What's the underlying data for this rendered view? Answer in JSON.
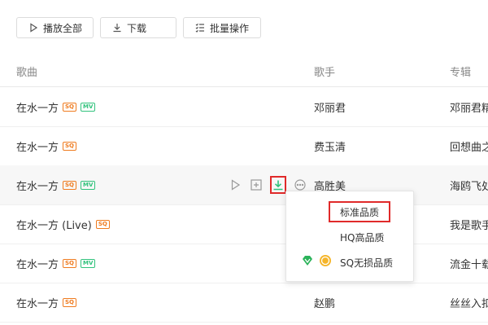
{
  "toolbar": {
    "play_all": "播放全部",
    "download": "下载",
    "batch": "批量操作"
  },
  "header": {
    "song": "歌曲",
    "singer": "歌手",
    "album": "专辑"
  },
  "rows": [
    {
      "song": "在水一方",
      "sq": "SQ",
      "mv": "MV",
      "singer": "邓丽君",
      "album": "邓丽君精"
    },
    {
      "song": "在水一方",
      "sq": "SQ",
      "mv": "",
      "singer": "费玉清",
      "album": "回想曲之"
    },
    {
      "song": "在水一方",
      "sq": "SQ",
      "mv": "MV",
      "singer": "高胜美",
      "album": "海鸥飞处"
    },
    {
      "song": "在水一方 (Live)",
      "sq": "SQ",
      "mv": "",
      "singer": "",
      "album": "我是歌手"
    },
    {
      "song": "在水一方",
      "sq": "SQ",
      "mv": "MV",
      "singer": "",
      "album": "流金十载"
    },
    {
      "song": "在水一方",
      "sq": "SQ",
      "mv": "",
      "singer": "赵鹏",
      "album": "丝丝入扣"
    }
  ],
  "download_menu": {
    "standard": "标准品质",
    "hq": "HQ高品质",
    "sq": "SQ无损品质"
  },
  "colors": {
    "accent": "#31c27c",
    "sq_badge": "#ef7b1f",
    "highlight": "#e02a2a"
  }
}
